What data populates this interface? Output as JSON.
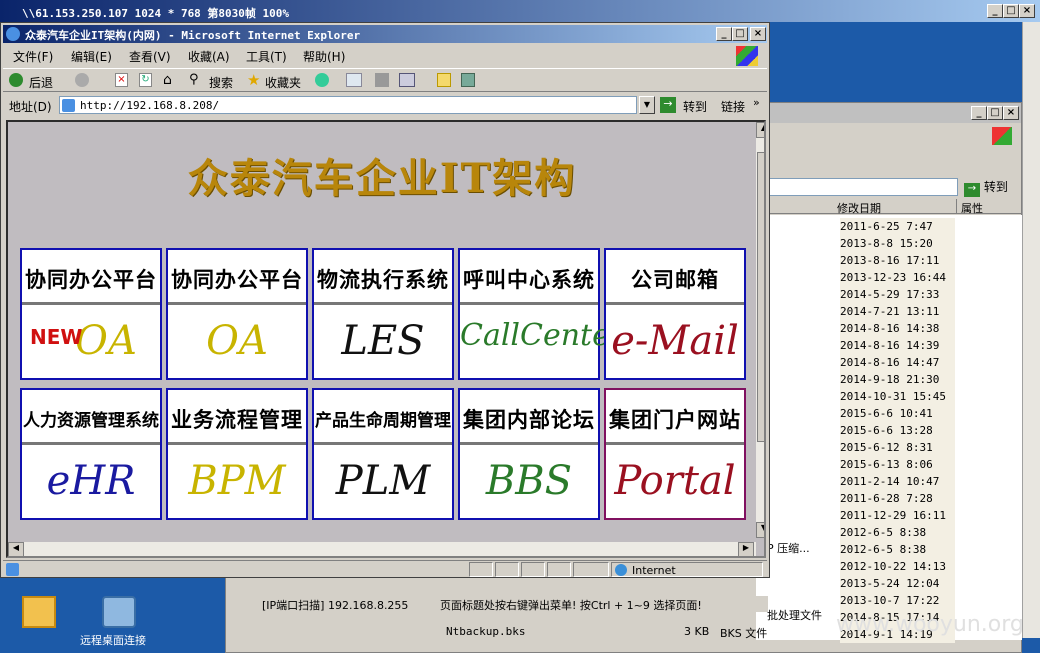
{
  "rdp": {
    "title": "\\\\61.153.250.107 1024 * 768 第8030帧 100%"
  },
  "ie": {
    "title": "众泰汽车企业IT架构(内网) - Microsoft Internet Explorer",
    "menu": [
      "文件(F)",
      "编辑(E)",
      "查看(V)",
      "收藏(A)",
      "工具(T)",
      "帮助(H)"
    ],
    "toolbar": {
      "back": "后退",
      "search": "搜索",
      "favorites": "收藏夹"
    },
    "address_label": "地址(D)",
    "address": "http://192.168.8.208/",
    "go": "转到",
    "links": "链接",
    "status_zone": "Internet"
  },
  "page": {
    "title": "众泰汽车企业IT架构",
    "tiles": [
      {
        "label": "协同办公平台",
        "logo": "OA",
        "new": "NEW",
        "color": "#c8b400"
      },
      {
        "label": "协同办公平台",
        "logo": "OA",
        "color": "#c8b400"
      },
      {
        "label": "物流执行系统",
        "logo": "LES",
        "color": "#111111"
      },
      {
        "label": "呼叫中心系统",
        "logo": "CallCenter",
        "color": "#2a7a2a"
      },
      {
        "label": "公司邮箱",
        "logo": "e-Mail",
        "color": "#9a1020"
      },
      {
        "label": "人力资源管理系统",
        "logo": "eHR",
        "color": "#1a1aa0"
      },
      {
        "label": "业务流程管理",
        "logo": "BPM",
        "color": "#c8b400"
      },
      {
        "label": "产品生命周期管理",
        "logo": "PLM",
        "color": "#111111"
      },
      {
        "label": "集团内部论坛",
        "logo": "BBS",
        "color": "#2a7a2a"
      },
      {
        "label": "集团门户网站",
        "logo": "Portal",
        "color": "#9a1020"
      }
    ]
  },
  "explorer": {
    "go": "转到",
    "columns": [
      "修改日期",
      "属性"
    ],
    "dates": [
      "2011-6-25 7:47",
      "2013-8-8 15:20",
      "2013-8-16 17:11",
      "2013-12-23 16:44",
      "2014-5-29 17:33",
      "2014-7-21 13:11",
      "2014-8-16 14:38",
      "2014-8-16 14:39",
      "2014-8-16 14:47",
      "2014-9-18 21:30",
      "2014-10-31 15:45",
      "2015-6-6 10:41",
      "2015-6-6 13:28",
      "2015-6-12 8:31",
      "2015-6-13 8:06",
      "2011-2-14 10:47",
      "2011-6-28 7:28",
      "2011-12-29 16:11",
      "2012-6-5 8:38",
      "2012-6-5 8:38",
      "2012-10-22 14:13",
      "2013-5-24 12:04",
      "2013-10-7 17:22",
      "2014-8-15 17:14",
      "2014-9-1 14:19"
    ],
    "side_labels": [
      "P 压缩...",
      "批处理文件"
    ],
    "file_row": {
      "name": "Ntbackup.bks",
      "size": "3 KB",
      "type": "BKS 文件"
    }
  },
  "status_bar": {
    "scan": "[IP端口扫描] 192.168.8.255",
    "hint": "页面标题处按右键弹出菜单! 按Ctrl + 1~9 选择页面!"
  },
  "desktop": {
    "icon2_label": "远程桌面连接"
  },
  "watermark": "www.wooyun.org"
}
